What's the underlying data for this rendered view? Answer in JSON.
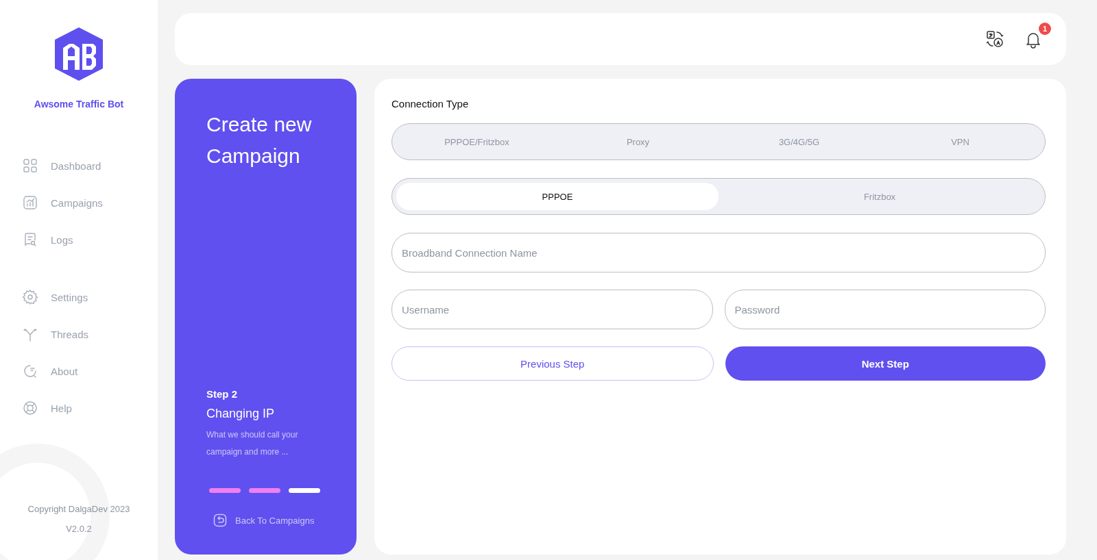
{
  "brand": {
    "name": "Awsome Traffic Bot"
  },
  "sidebar": {
    "groups": [
      [
        {
          "label": "Dashboard"
        },
        {
          "label": "Campaigns"
        },
        {
          "label": "Logs"
        }
      ],
      [
        {
          "label": "Settings"
        },
        {
          "label": "Threads"
        },
        {
          "label": "About"
        },
        {
          "label": "Help"
        }
      ]
    ],
    "copyright": "Copyright DalgaDev 2023",
    "version": "V2.0.2"
  },
  "topbar": {
    "notification_count": "1"
  },
  "step_panel": {
    "title": "Create new Campaign",
    "step": "Step 2",
    "step_title": "Changing IP",
    "description": "What we should call your campaign and more ...",
    "progress": [
      {
        "completed": true
      },
      {
        "completed": true
      },
      {
        "completed": false
      }
    ],
    "back_link": "Back To Campaigns"
  },
  "form": {
    "section_label": "Connection Type",
    "connection_tabs": [
      {
        "label": "PPPOE/Fritzbox",
        "selected": false
      },
      {
        "label": "Proxy",
        "selected": false
      },
      {
        "label": "3G/4G/5G",
        "selected": false
      },
      {
        "label": "VPN",
        "selected": false
      }
    ],
    "sub_tabs": [
      {
        "label": "PPPOE",
        "selected": true
      },
      {
        "label": "Fritzbox",
        "selected": false
      }
    ],
    "fields": [
      [
        {
          "placeholder": "Broadband Connection Name"
        }
      ],
      [
        {
          "placeholder": "Username"
        },
        {
          "placeholder": "Password"
        }
      ]
    ],
    "buttons": [
      {
        "label": "Previous Step",
        "kind": "secondary"
      },
      {
        "label": "Next Step",
        "kind": "primary"
      }
    ]
  }
}
